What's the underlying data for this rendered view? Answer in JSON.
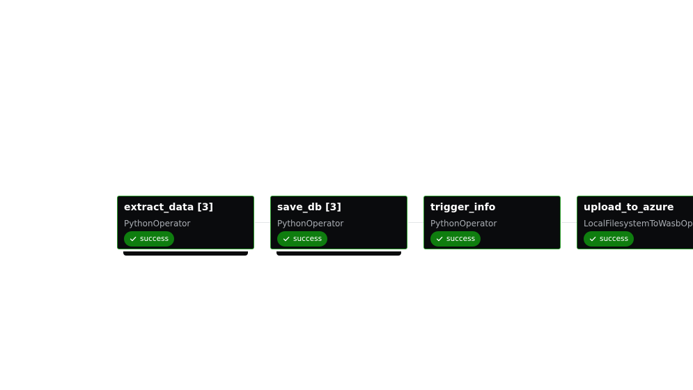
{
  "nodes": [
    {
      "title": "extract_data [3]",
      "operator": "PythonOperator",
      "status": "success",
      "status_icon": "check-icon",
      "mapped": true
    },
    {
      "title": "save_db [3]",
      "operator": "PythonOperator",
      "status": "success",
      "status_icon": "check-icon",
      "mapped": true
    },
    {
      "title": "trigger_info",
      "operator": "PythonOperator",
      "status": "success",
      "status_icon": "check-icon",
      "mapped": false
    },
    {
      "title": "upload_to_azure",
      "operator": "LocalFilesystemToWasbOperator",
      "status": "success",
      "status_icon": "check-icon",
      "mapped": false
    }
  ],
  "colors": {
    "node_background": "#0a0b0d",
    "node_border": "#2a9b2a",
    "status_success": "#0f7d0f",
    "edge": "#e4e6e8"
  }
}
